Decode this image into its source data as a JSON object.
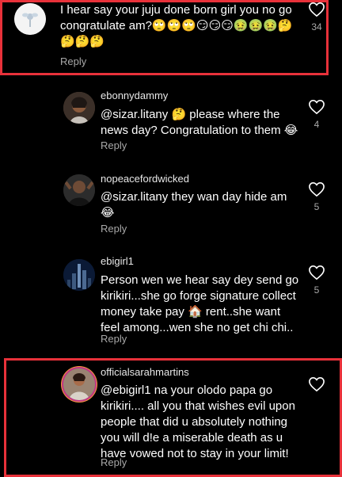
{
  "comments": [
    {
      "username": "",
      "text": "I hear say your juju done born girl you no go congratulate am?🙄🙄🙄😏😏😏🤢🤢🤢🤔🤔🤔🤔",
      "reply": "Reply",
      "likes": "34",
      "avatar": "avatar-flower",
      "highlighted": true
    },
    {
      "username": "ebonnydammy",
      "mention": "@sizar.litany",
      "text": "🤔 please where the news day? Congratulation to them 😂",
      "reply": "Reply",
      "likes": "4",
      "avatar": "avatar-woman"
    },
    {
      "username": "nopeacefordwicked",
      "mention": "@sizar.litany",
      "text": "they wan day hide am 😂",
      "reply": "Reply",
      "likes": "5",
      "avatar": "avatar-man"
    },
    {
      "username": "ebigirl1",
      "text": "Person wen we hear say dey send go kirikiri...she go forge signature collect money take pay 🏠 rent..she want feel among...wen she no get chi chi..",
      "reply": "Reply",
      "likes": "5",
      "avatar": "avatar-city"
    },
    {
      "username": "officialsarahmartins",
      "mention": "@ebigirl1",
      "text": "na your olodo papa go kirikiri.... all you that wishes evil upon people that did u absolutely nothing you will d!e a miserable death as u have vowed not to stay in your limit!",
      "reply": "Reply",
      "likes": "",
      "avatar": "avatar-story-ring",
      "highlighted": true
    }
  ],
  "colors": {
    "background": "#000000",
    "highlight": "#e8313a",
    "muted": "#a8a8a8"
  }
}
